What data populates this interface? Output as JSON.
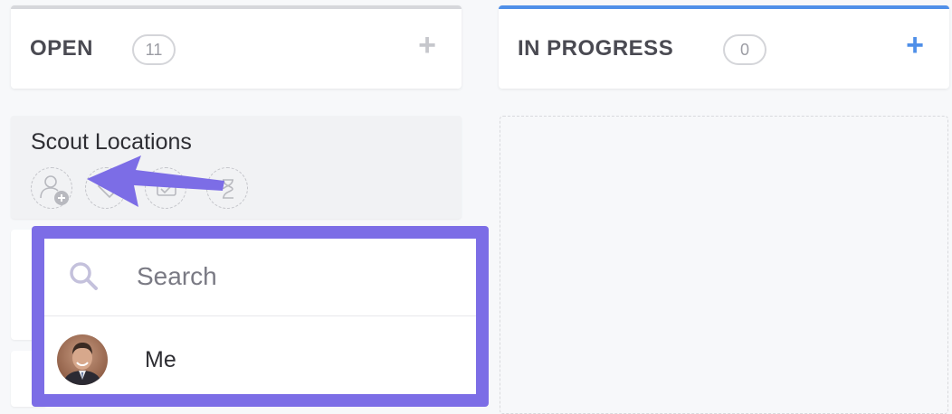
{
  "columns": [
    {
      "title": "OPEN",
      "count": "11",
      "add_label": "+"
    },
    {
      "title": "IN PROGRESS",
      "count": "0",
      "add_label": "+"
    }
  ],
  "task": {
    "title": "Scout Locations",
    "action_icons": [
      "add-assignee-icon",
      "tag-icon",
      "checklist-icon",
      "timer-icon"
    ]
  },
  "assignee_dropdown": {
    "search_placeholder": "Search",
    "users": [
      {
        "name": "Me",
        "avatar": "user-avatar"
      }
    ]
  },
  "colors": {
    "open_accent": "#d6d7db",
    "in_progress_accent": "#4f8fe8",
    "highlight": "#7c6de6"
  }
}
